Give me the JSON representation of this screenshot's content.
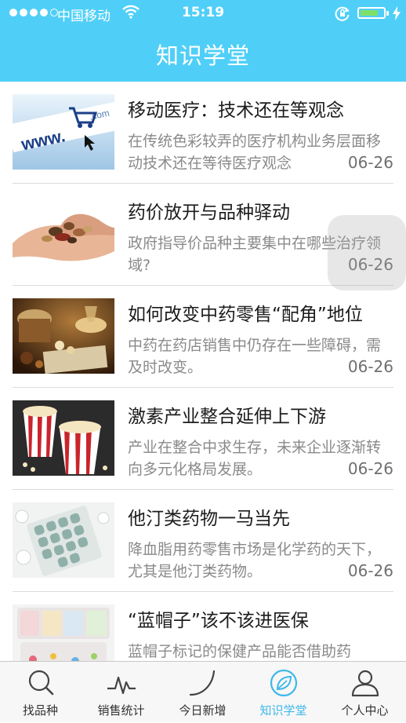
{
  "status_bar": {
    "carrier": "中国移动",
    "time": "15:19",
    "battery_level": 0.8,
    "battery_color": "#7ee06a"
  },
  "header": {
    "title": "知识学堂",
    "background": "#4fcff8"
  },
  "articles": [
    {
      "title": "移动医疗：技术还在等观念",
      "summary": "在传统色彩较弄的医疗机构业务层面移动技术还在等待医疗观念",
      "date": "06-26",
      "image": "web-browser-cart"
    },
    {
      "title": "药价放开与品种驿动",
      "summary": "政府指导价品种主要集中在哪些治疗领域?",
      "date": "06-26",
      "image": "hand-holding-herbs"
    },
    {
      "title": "如何改变中药零售“配角”地位",
      "summary": "中药在药店销售中仍存在一些障碍，需及时改变。",
      "date": "06-26",
      "image": "chinese-medicine-still-life"
    },
    {
      "title": "激素产业整合延伸上下游",
      "summary": "产业在整合中求生存，未来企业逐渐转向多元化格局发展。",
      "date": "06-26",
      "image": "popcorn-boxes"
    },
    {
      "title": "他汀类药物一马当先",
      "summary": "降血脂用药零售市场是化学药的天下，尤其是他汀类药物。",
      "date": "06-26",
      "image": "pill-blister-pack"
    },
    {
      "title": "“蓝帽子”该不该进医保",
      "summary": "蓝帽子标记的保健产品能否借助药",
      "date": "",
      "image": "pill-organizer"
    }
  ],
  "tabbar": {
    "active_color": "#3fb8e9",
    "tabs": [
      {
        "label": "找品种",
        "icon": "search-icon",
        "active": false
      },
      {
        "label": "销售统计",
        "icon": "pulse-chart-icon",
        "active": false
      },
      {
        "label": "今日新增",
        "icon": "new-arc-icon",
        "active": false
      },
      {
        "label": "知识学堂",
        "icon": "leaf-icon",
        "active": true
      },
      {
        "label": "个人中心",
        "icon": "user-icon",
        "active": false
      }
    ]
  }
}
